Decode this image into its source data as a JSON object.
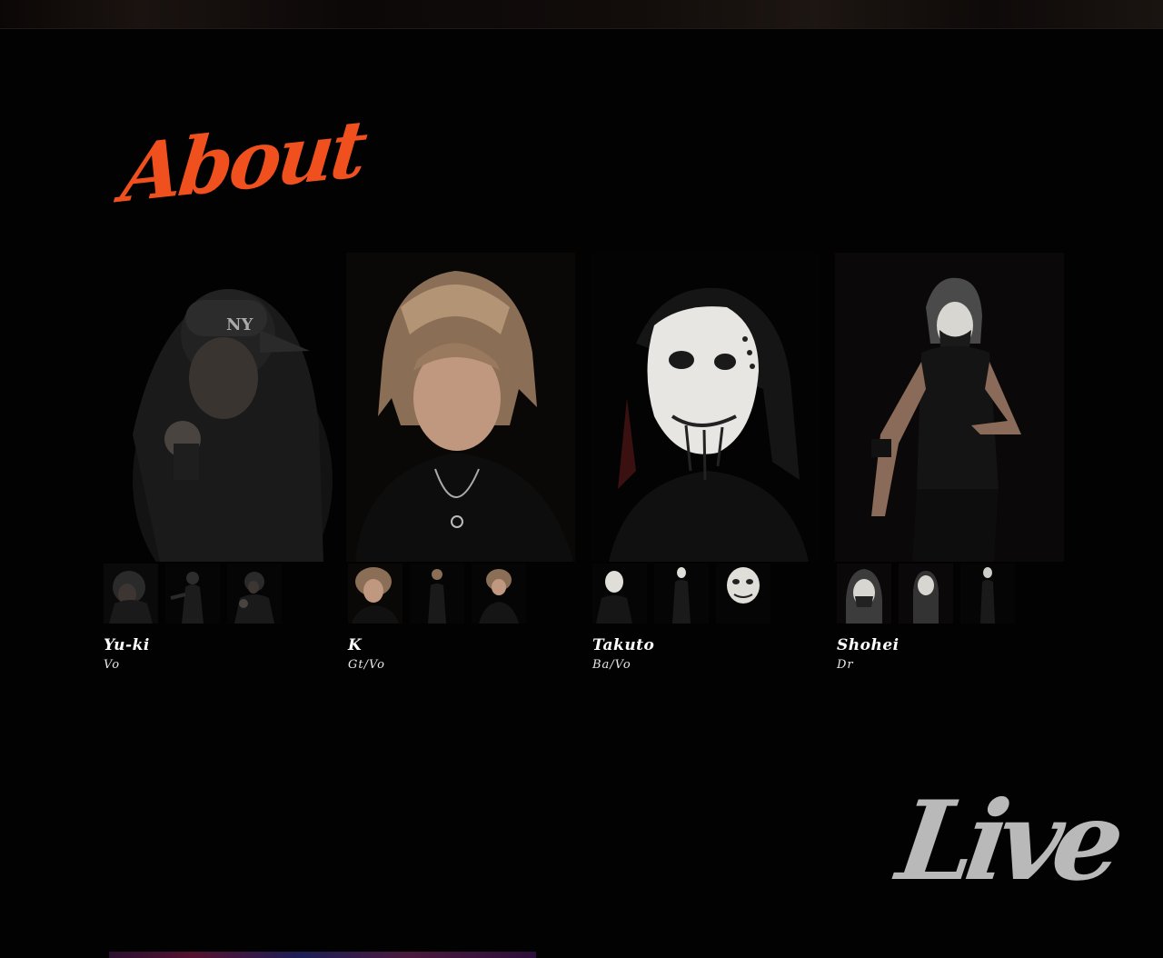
{
  "colors": {
    "background": "#030203",
    "accent": "#f0501e",
    "live_title": "#b9b9b9"
  },
  "about": {
    "title": "About"
  },
  "members": [
    {
      "name": "Yu-ki",
      "role": "Vo"
    },
    {
      "name": "K",
      "role": "Gt/Vo"
    },
    {
      "name": "Takuto",
      "role": "Ba/Vo"
    },
    {
      "name": "Shohei",
      "role": "Dr"
    }
  ],
  "live": {
    "title": "Live"
  }
}
